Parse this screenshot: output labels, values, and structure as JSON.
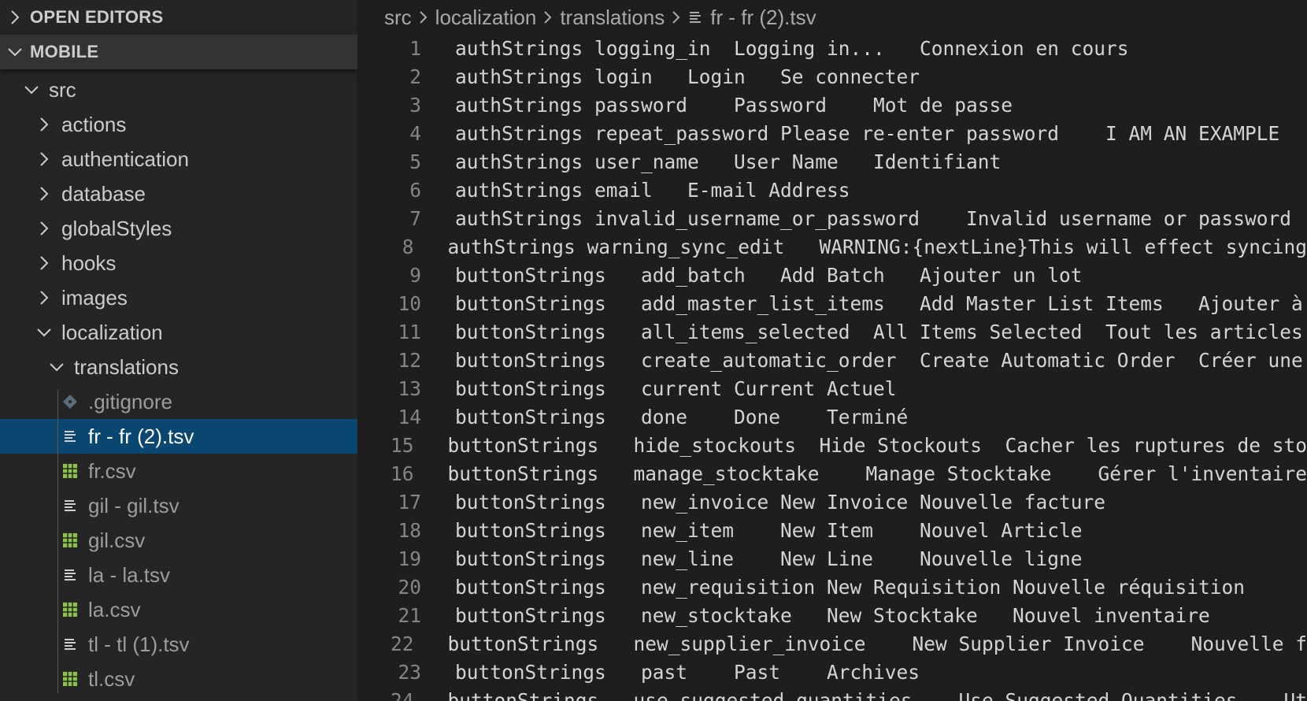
{
  "sidebar": {
    "open_editors": "OPEN EDITORS",
    "workspace": "MOBILE",
    "tree": [
      {
        "label": "src",
        "kind": "folder",
        "open": true,
        "indent": 0
      },
      {
        "label": "actions",
        "kind": "folder",
        "open": false,
        "indent": 1
      },
      {
        "label": "authentication",
        "kind": "folder",
        "open": false,
        "indent": 1
      },
      {
        "label": "database",
        "kind": "folder",
        "open": false,
        "indent": 1
      },
      {
        "label": "globalStyles",
        "kind": "folder",
        "open": false,
        "indent": 1
      },
      {
        "label": "hooks",
        "kind": "folder",
        "open": false,
        "indent": 1
      },
      {
        "label": "images",
        "kind": "folder",
        "open": false,
        "indent": 1
      },
      {
        "label": "localization",
        "kind": "folder",
        "open": true,
        "indent": 1
      },
      {
        "label": "translations",
        "kind": "folder",
        "open": true,
        "indent": 2
      },
      {
        "label": ".gitignore",
        "kind": "file",
        "icon": "git-icon",
        "indent": 3
      },
      {
        "label": "fr - fr (2).tsv",
        "kind": "file",
        "icon": "text-file-icon",
        "indent": 3,
        "selected": true
      },
      {
        "label": "fr.csv",
        "kind": "file",
        "icon": "csv-table-icon",
        "indent": 3
      },
      {
        "label": "gil - gil.tsv",
        "kind": "file",
        "icon": "text-file-icon",
        "indent": 3
      },
      {
        "label": "gil.csv",
        "kind": "file",
        "icon": "csv-table-icon",
        "indent": 3
      },
      {
        "label": "la - la.tsv",
        "kind": "file",
        "icon": "text-file-icon",
        "indent": 3
      },
      {
        "label": "la.csv",
        "kind": "file",
        "icon": "csv-table-icon",
        "indent": 3
      },
      {
        "label": "tl - tl (1).tsv",
        "kind": "file",
        "icon": "text-file-icon",
        "indent": 3
      },
      {
        "label": "tl.csv",
        "kind": "file",
        "icon": "csv-table-icon",
        "indent": 3
      }
    ]
  },
  "breadcrumb": {
    "parts": [
      "src",
      "localization",
      "translations"
    ],
    "file": "fr - fr (2).tsv"
  },
  "editor": {
    "lines": [
      "authStrings logging_in  Logging in...   Connexion en cours",
      "authStrings login   Login   Se connecter",
      "authStrings password    Password    Mot de passe",
      "authStrings repeat_password Please re-enter password    I AM AN EXAMPLE",
      "authStrings user_name   User Name   Identifiant",
      "authStrings email   E-mail Address",
      "authStrings invalid_username_or_password    Invalid username or password",
      "authStrings warning_sync_edit   WARNING:{nextLine}This will effect syncing",
      "buttonStrings   add_batch   Add Batch   Ajouter un lot",
      "buttonStrings   add_master_list_items   Add Master List Items   Ajouter à",
      "buttonStrings   all_items_selected  All Items Selected  Tout les articles",
      "buttonStrings   create_automatic_order  Create Automatic Order  Créer une",
      "buttonStrings   current Current Actuel",
      "buttonStrings   done    Done    Terminé",
      "buttonStrings   hide_stockouts  Hide Stockouts  Cacher les ruptures de sto",
      "buttonStrings   manage_stocktake    Manage Stocktake    Gérer l'inventaire",
      "buttonStrings   new_invoice New Invoice Nouvelle facture",
      "buttonStrings   new_item    New Item    Nouvel Article",
      "buttonStrings   new_line    New Line    Nouvelle ligne",
      "buttonStrings   new_requisition New Requisition Nouvelle réquisition",
      "buttonStrings   new_stocktake   New Stocktake   Nouvel inventaire",
      "buttonStrings   new_supplier_invoice    New Supplier Invoice    Nouvelle f",
      "buttonStrings   past    Past    Archives",
      "buttonStrings   use_suggested_quantities    Use Suggested Quantities    Ut"
    ]
  },
  "colors": {
    "sidebar_bg": "#252526",
    "editor_bg": "#1e1e1e",
    "selection_bg": "#094771",
    "csv_icon": "#8bc34a",
    "git_icon": "#5a6b7a"
  }
}
